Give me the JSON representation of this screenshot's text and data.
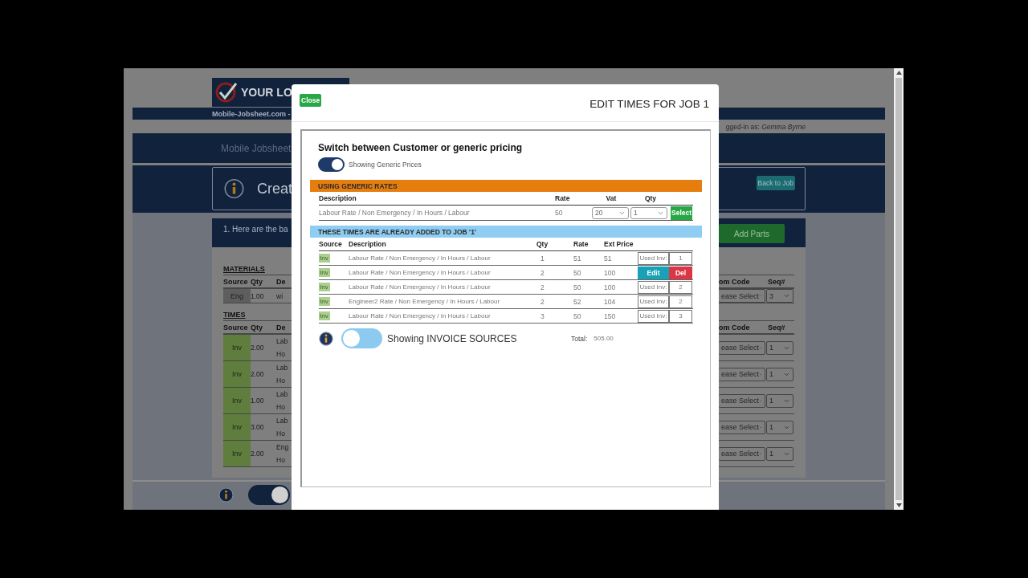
{
  "background_page": {
    "logo_text": "YOUR LO",
    "site_bar_text": "Mobile-Jobsheet.com -",
    "logged_in_label": "gged-in as:",
    "logged_in_user": "Gemma Byrne",
    "nav_title": "Mobile Jobsheet",
    "page_title": "Creat",
    "back_button": "Back to Job",
    "panel_heading": "1. Here are the ba",
    "add_parts_button": "Add Parts",
    "materials": {
      "title": "MATERIALS",
      "columns": [
        "Source",
        "Qty",
        "De"
      ],
      "right_columns": [
        "om Code",
        "Seq#"
      ],
      "rows": [
        {
          "source": "Eng",
          "kind": "engineer",
          "qty": "1.00",
          "description": [
            "wi"
          ],
          "code": "ease Select",
          "seq": "3"
        }
      ]
    },
    "times": {
      "title": "TIMES",
      "columns": [
        "Source",
        "Qty",
        "De"
      ],
      "right_columns": [
        "om Code",
        "Seq#"
      ],
      "rows": [
        {
          "source": "Inv",
          "kind": "invoice",
          "qty": "2.00",
          "description": [
            "Lab",
            "Ho"
          ],
          "code": "ease Select",
          "seq": "1"
        },
        {
          "source": "Inv",
          "kind": "invoice",
          "qty": "2.00",
          "description": [
            "Lab",
            "Ho"
          ],
          "code": "ease Select",
          "seq": "1"
        },
        {
          "source": "Inv",
          "kind": "invoice",
          "qty": "1.00",
          "description": [
            "Lab",
            "Ho"
          ],
          "code": "ease Select",
          "seq": "1"
        },
        {
          "source": "Inv",
          "kind": "invoice",
          "qty": "3.00",
          "description": [
            "Lab",
            "Ho"
          ],
          "code": "ease Select",
          "seq": "1"
        },
        {
          "source": "Inv",
          "kind": "invoice",
          "qty": "2.00",
          "description": [
            "Eng",
            "Ho"
          ],
          "code": "ease Select",
          "seq": "1"
        }
      ]
    },
    "footer_toggle": {
      "on": true
    }
  },
  "modal": {
    "close_button": "Close",
    "title": "EDIT TIMES FOR JOB 1",
    "pricing": {
      "heading": "Switch between Customer or generic pricing",
      "toggle_on": true,
      "toggle_label": "Showing Generic Prices"
    },
    "generic_rates": {
      "banner": "USING GENERIC RATES",
      "columns": [
        "Description",
        "Rate",
        "Vat",
        "Qty"
      ],
      "rows": [
        {
          "description": "Labour Rate / Non Emergency / In Hours / Labour",
          "rate": "50",
          "vat": "20",
          "qty": "1",
          "button": "Select"
        }
      ]
    },
    "added_times": {
      "banner": "THESE TIMES ARE ALREADY ADDED TO JOB '1'",
      "columns": [
        "Source",
        "Description",
        "Qty",
        "Rate",
        "Ext Price"
      ],
      "rows": [
        {
          "source": "Inv",
          "description": "Labour Rate / Non Emergency / In Hours / Labour",
          "qty": "1",
          "rate": "51",
          "ext_price": "51",
          "kind": "used",
          "used_label": "Used Inv:",
          "seq": "1"
        },
        {
          "source": "Inv",
          "description": "Labour Rate / Non Emergency / In Hours / Labour",
          "qty": "2",
          "rate": "50",
          "ext_price": "100",
          "kind": "editable",
          "edit_button": "Edit",
          "delete_button": "Del"
        },
        {
          "source": "Inv",
          "description": "Labour Rate / Non Emergency / In Hours / Labour",
          "qty": "2",
          "rate": "50",
          "ext_price": "100",
          "kind": "used",
          "used_label": "Used Inv:",
          "seq": "2"
        },
        {
          "source": "Inv",
          "description": "Engineer2 Rate / Non Emergency / In Hours / Labour",
          "qty": "2",
          "rate": "52",
          "ext_price": "104",
          "kind": "used",
          "used_label": "Used Inv:",
          "seq": "2"
        },
        {
          "source": "Inv",
          "description": "Labour Rate / Non Emergency / In Hours / Labour",
          "qty": "3",
          "rate": "50",
          "ext_price": "150",
          "kind": "used",
          "used_label": "Used Inv:",
          "seq": "3"
        }
      ]
    },
    "invoice_toggle": {
      "on": false,
      "label": "Showing INVOICE SOURCES"
    },
    "total_label": "Total:",
    "total_value": "505.00"
  }
}
